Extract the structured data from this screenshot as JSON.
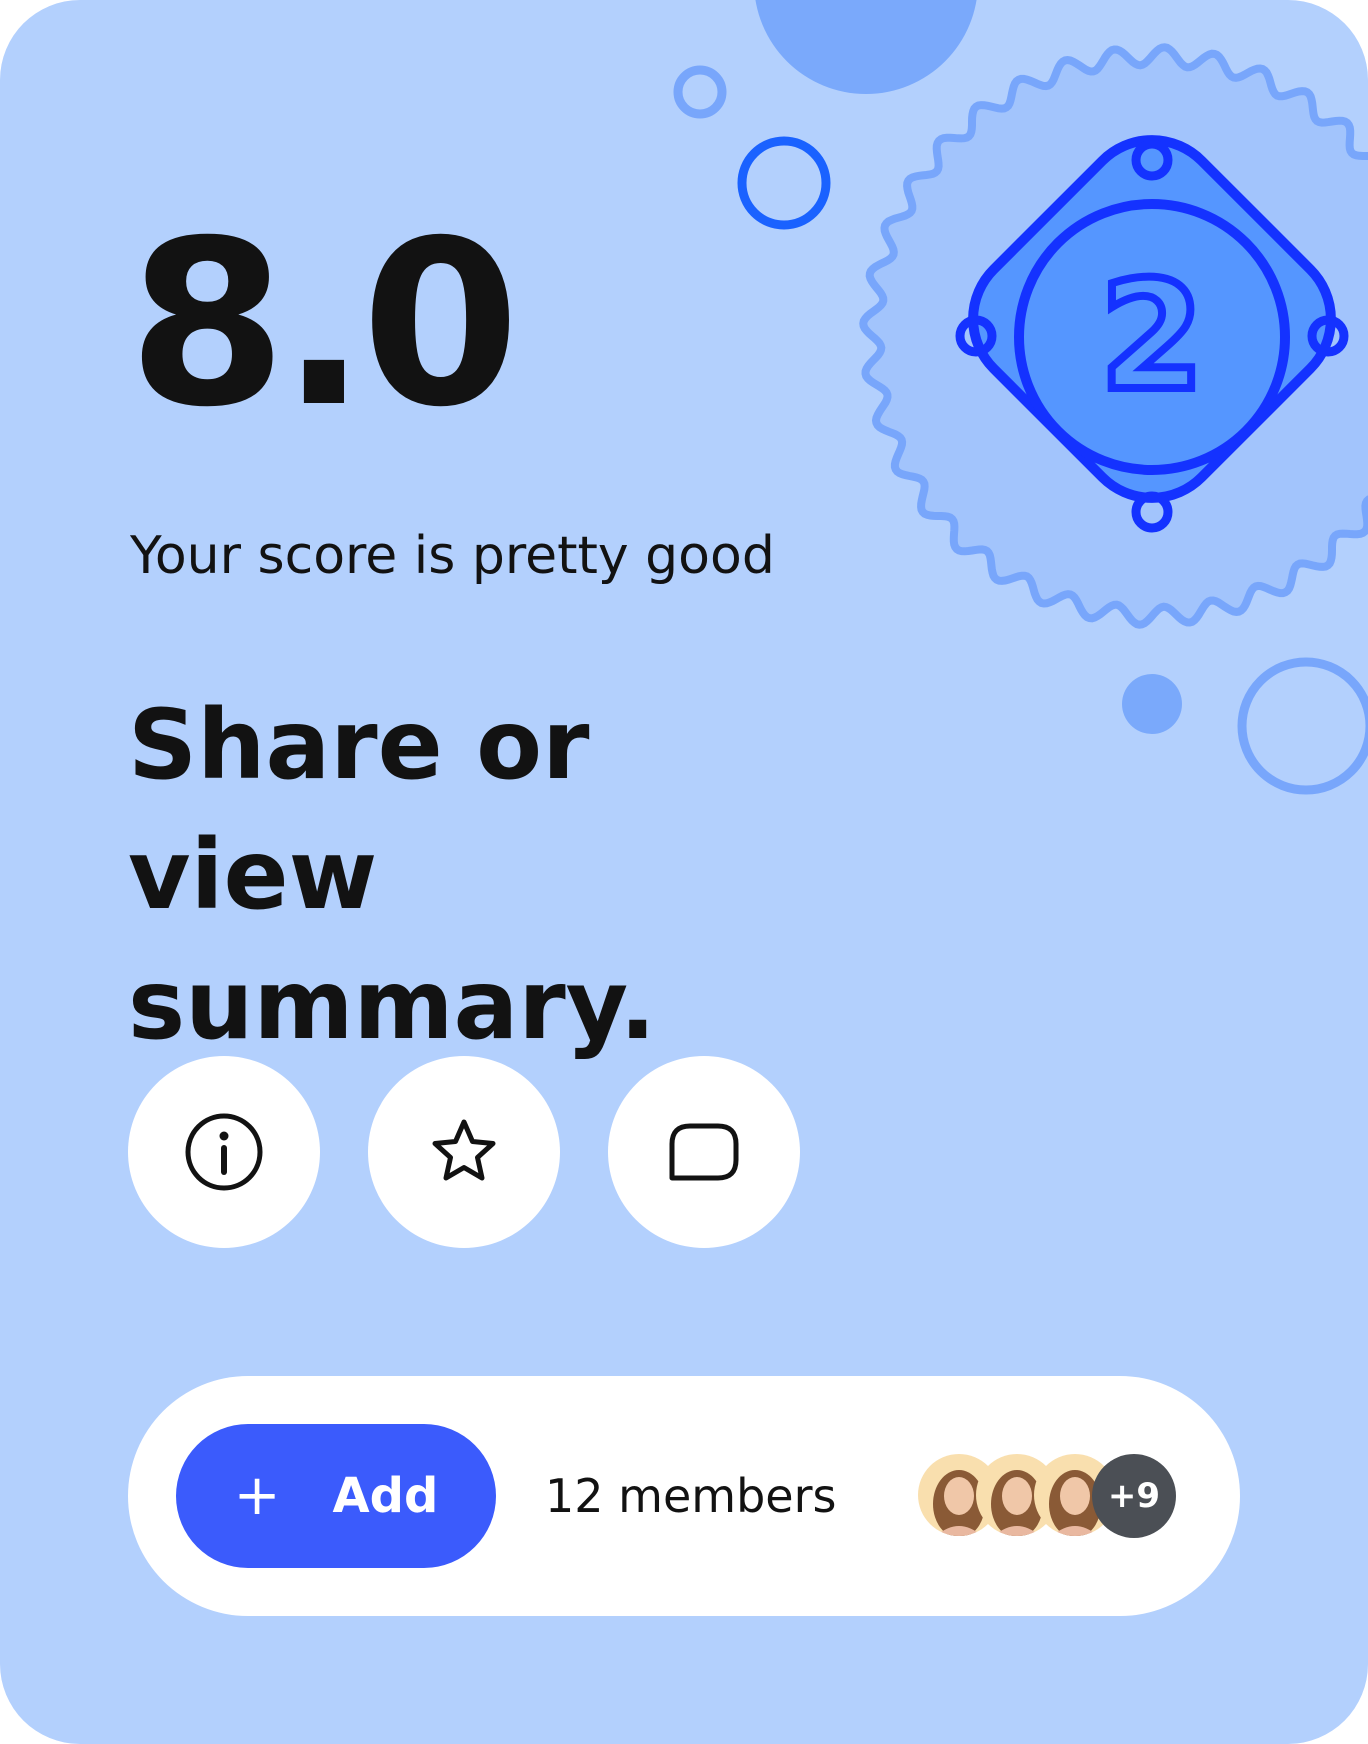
{
  "card": {
    "score": "8.0",
    "subtitle": "Your score is pretty good",
    "headline": "Share or view summary."
  },
  "badge": {
    "number": "2"
  },
  "actions": [
    {
      "icon": "info-icon"
    },
    {
      "icon": "star-icon"
    },
    {
      "icon": "chat-bubble-icon"
    }
  ],
  "members_bar": {
    "add_label": "Add",
    "add_icon": "plus-icon",
    "members_text": "12 members",
    "more_count": "+9"
  },
  "colors": {
    "card_background": "#b3d0fd",
    "accent_blue": "#3b5bfc",
    "badge_stroke": "#1432ff",
    "badge_fill": "#5596ff"
  }
}
